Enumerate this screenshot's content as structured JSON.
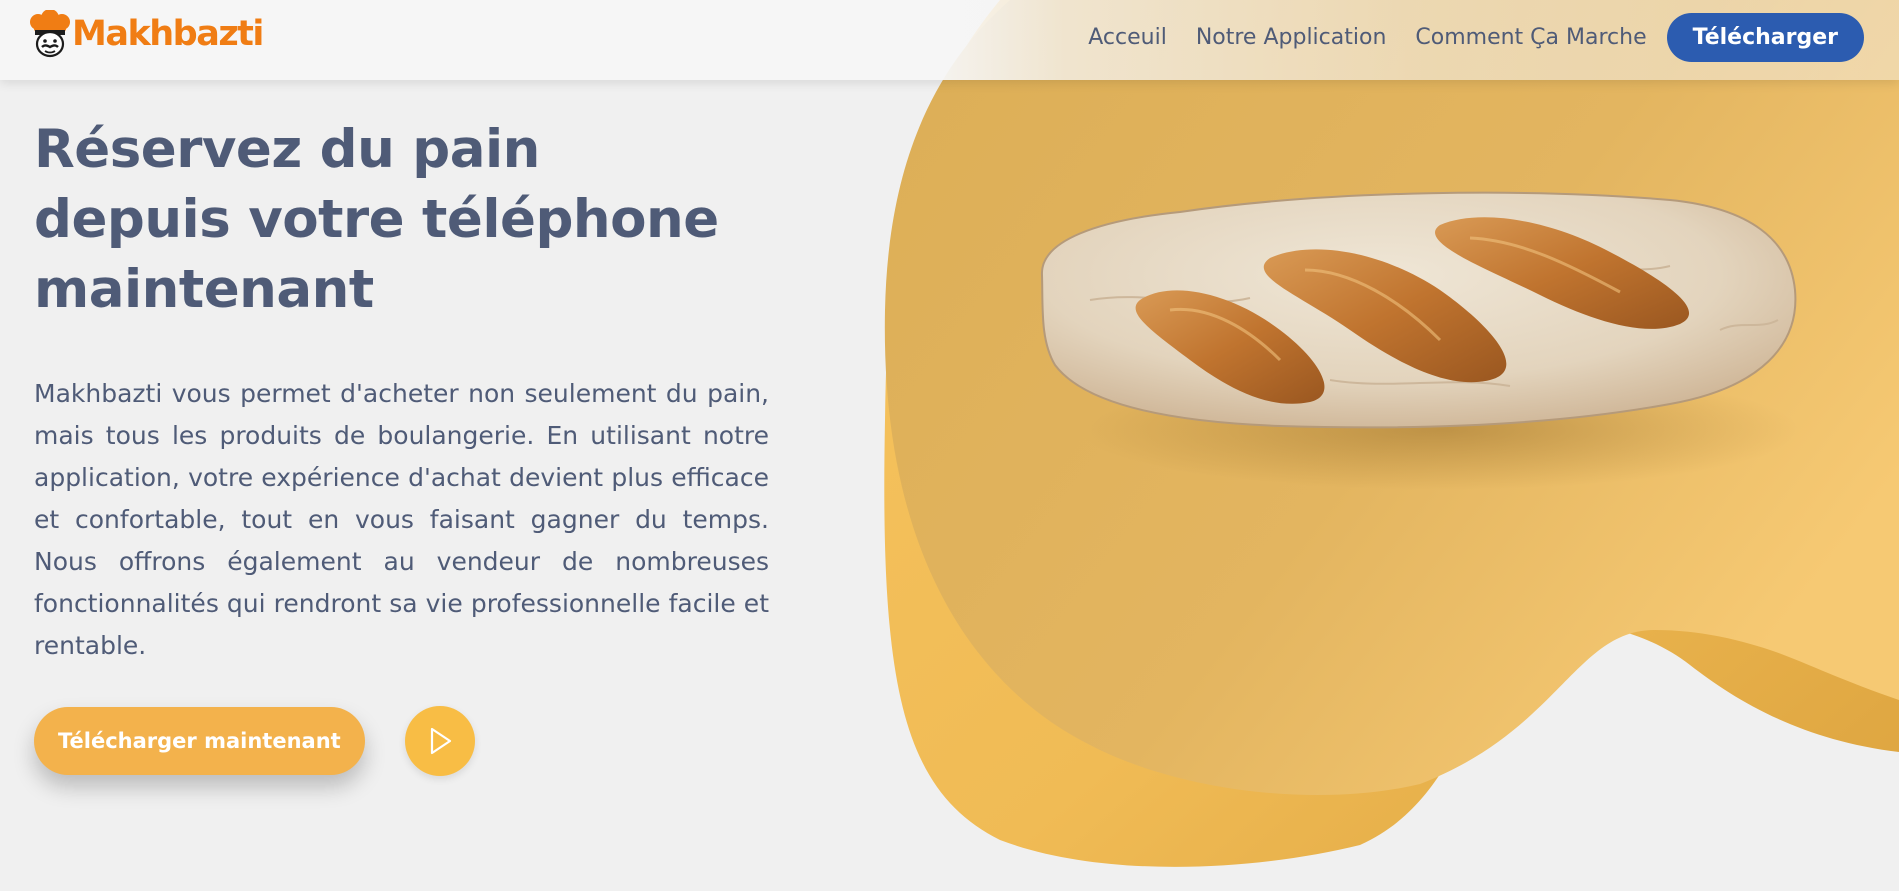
{
  "brand": {
    "name": "Makhbazti",
    "color": "#f07d14"
  },
  "nav": {
    "links": [
      "Acceuil",
      "Notre Application",
      "Comment Ça Marche"
    ],
    "cta_label": "Télécharger",
    "cta_color": "#2c5cb0"
  },
  "hero": {
    "title_lines": [
      "Réservez du pain",
      "depuis votre téléphone",
      "maintenant"
    ],
    "description": "Makhbazti vous permet d'acheter non seulement du pain, mais tous les produits de boulangerie. En utilisant notre application, votre expérience d'achat devient plus efficace et confortable, tout en vous faisant gagner du temps. Nous offrons également au vendeur de nombreuses fonctionnalités qui rendront sa vie professionnelle facile et rentable.",
    "primary_button": "Télécharger maintenant",
    "play_icon": "play-icon"
  },
  "colors": {
    "text": "#4f5b77",
    "accent": "#f3b24c",
    "background": "#f0f0f0"
  },
  "illustration": {
    "subject": "bread-loaf"
  }
}
